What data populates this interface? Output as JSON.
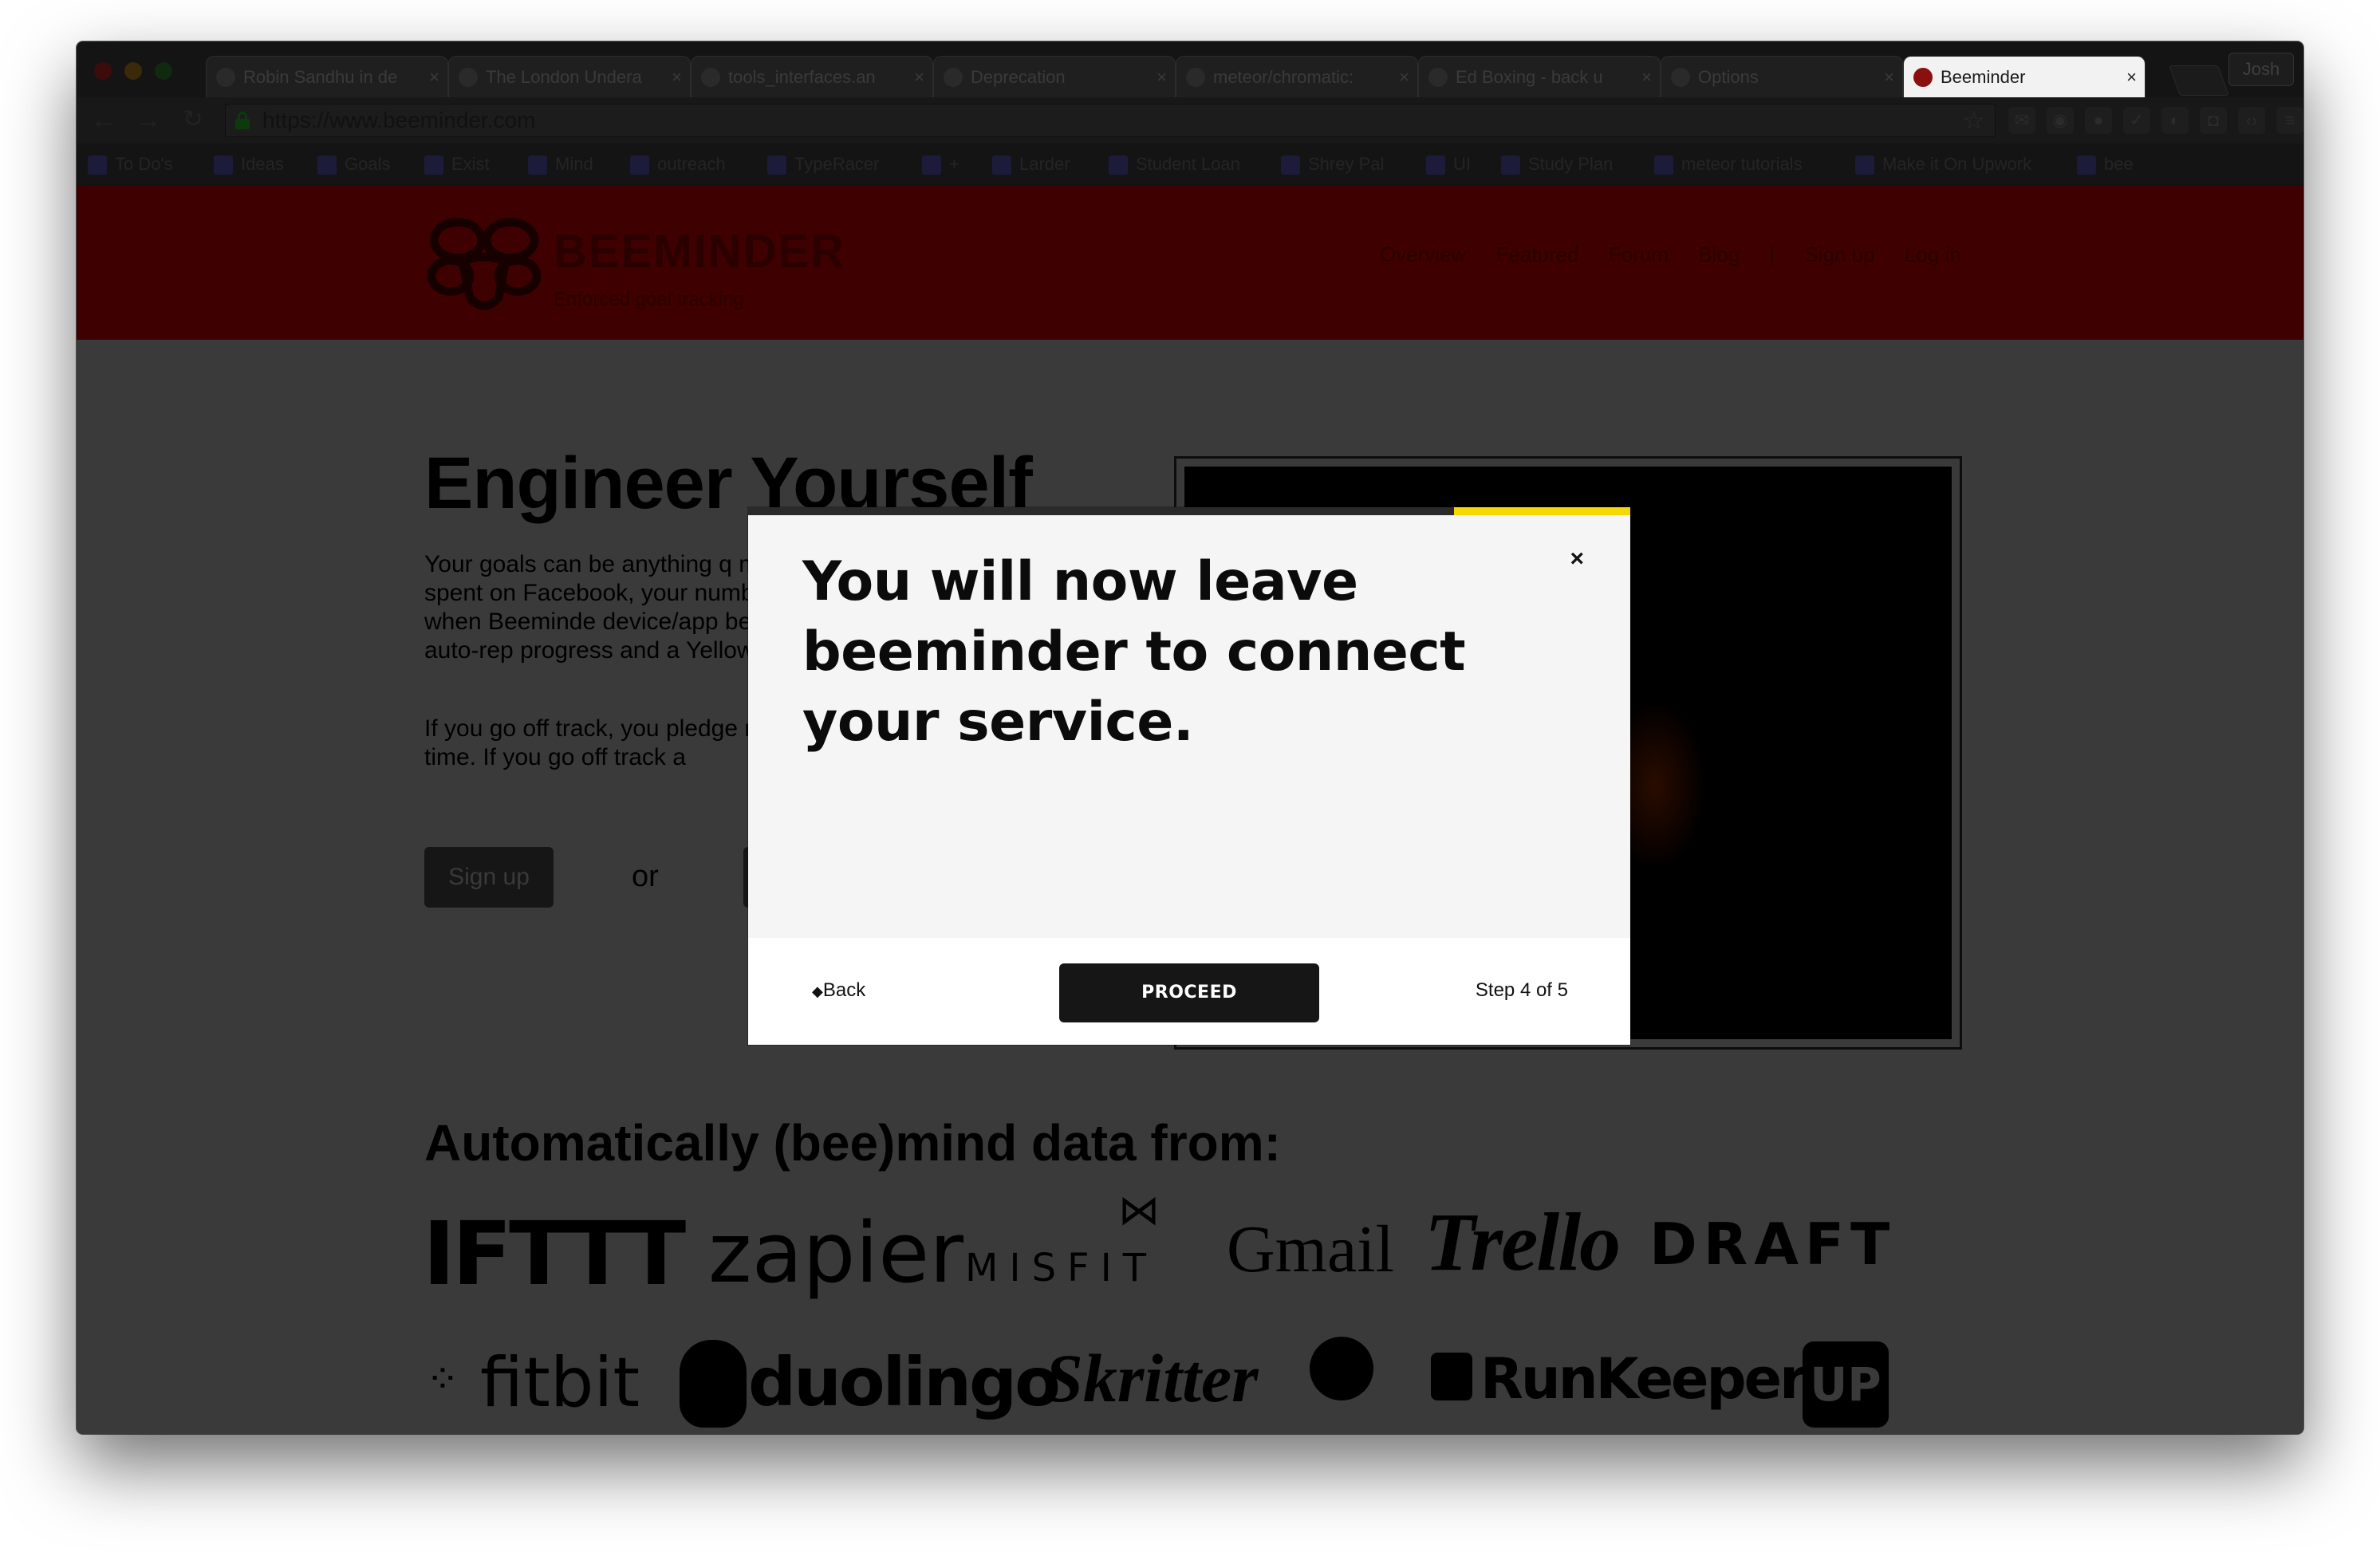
{
  "browser": {
    "tabs": [
      {
        "label": "Robin Sandhu in de"
      },
      {
        "label": "The London Undera"
      },
      {
        "label": "tools_interfaces.an"
      },
      {
        "label": "Deprecation"
      },
      {
        "label": "meteor/chromatic:"
      },
      {
        "label": "Ed Boxing - back u"
      },
      {
        "label": "Options"
      },
      {
        "label": "Beeminder"
      }
    ],
    "user_button": "Josh",
    "url": "https://www.beeminder.com",
    "bookmarks": [
      "To Do's",
      "Ideas",
      "Goals",
      "Exist",
      "Mind",
      "outreach",
      "TypeRacer",
      "+",
      "Larder",
      "Student Loan",
      "Shrey Pal",
      "UI",
      "Study Plan",
      "meteor tutorials",
      "Make it On Upwork",
      "bee"
    ]
  },
  "site": {
    "brand": "BEEMINDER",
    "tagline": "Enforced goal tracking",
    "nav": [
      "Overview",
      "Featured",
      "Forum",
      "Blog",
      "|",
      "Sign up",
      "Log in"
    ],
    "hero_title": "Engineer Yourself",
    "hero_para1": "Your goals can be anything q minutes spent on Facebook, your number when Beeminde device/app below to auto-rep progress and a Yellow Brick R",
    "hero_para2": "If you go off track, you pledge next time. If you go off track a",
    "signup_label": "Sign up",
    "or_label": "or",
    "services_title": "Automatically (bee)mind data from:",
    "services": [
      "IFTTT",
      "zapier",
      "MISFIT",
      "Gmail",
      "Trello",
      "DRAFT",
      "fitbit",
      "duolingo",
      "Skritter",
      "RunKeeper",
      "UP"
    ]
  },
  "modal": {
    "heading": "You will now leave beeminder to connect your service.",
    "close_label": "×",
    "back_label": "Back",
    "proceed_label": "PROCEED",
    "step_label": "Step 4 of 5",
    "progress_fraction": 0.8,
    "accent_color": "#f6d800"
  }
}
